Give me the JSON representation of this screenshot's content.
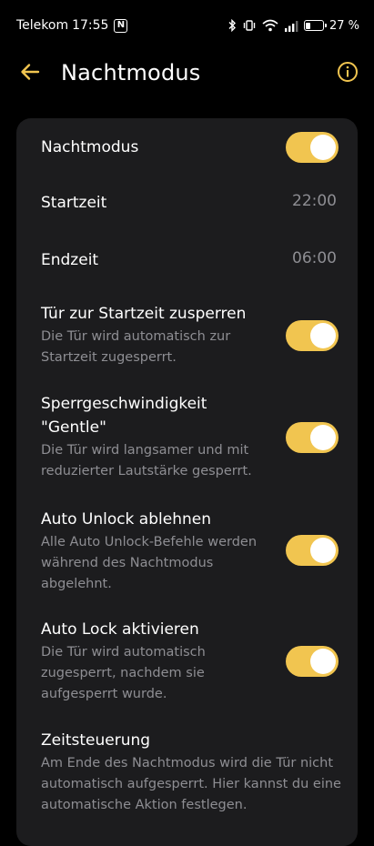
{
  "status_bar": {
    "carrier": "Telekom",
    "time": "17:55",
    "nfc_label": "N",
    "battery_percent": "27 %",
    "battery_level": 0.27
  },
  "header": {
    "title": "Nachtmodus",
    "back_icon": "arrow-left-icon",
    "info_icon": "info-circle-icon"
  },
  "colors": {
    "accent": "#f1c550",
    "card_bg": "#1c1c1e",
    "secondary_text": "#8e8e93"
  },
  "settings": [
    {
      "title": "Nachtmodus",
      "toggle_on": true
    },
    {
      "title": "Startzeit",
      "value": "22:00"
    },
    {
      "title": "Endzeit",
      "value": "06:00"
    },
    {
      "title": "Tür zur Startzeit zusperren",
      "description": "Die Tür wird automatisch zur Startzeit zugesperrt.",
      "toggle_on": true
    },
    {
      "title": "Sperrgeschwindigkeit \"Gentle\"",
      "description": "Die Tür wird langsamer und mit reduzierter Lautstärke gesperrt.",
      "toggle_on": true
    },
    {
      "title": "Auto Unlock ablehnen",
      "description": "Alle Auto Unlock-Befehle werden während des Nachtmodus abgelehnt.",
      "toggle_on": true
    },
    {
      "title": "Auto Lock aktivieren",
      "description": "Die Tür wird automatisch zugesperrt, nachdem sie aufgesperrt wurde.",
      "toggle_on": true
    },
    {
      "title": "Zeitsteuerung",
      "description": "Am Ende des Nachtmodus wird die Tür nicht automatisch aufgesperrt. Hier kannst du eine automatische Aktion festlegen."
    }
  ]
}
